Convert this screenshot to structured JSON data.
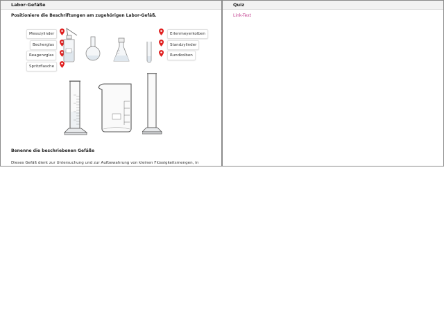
{
  "left": {
    "title": "Labor-Gefäße",
    "instruction": "Positioniere die Beschriftungen am zugehörigen Labor-Gefäß.",
    "labels_left": [
      "Messzylinder",
      "Becherglas",
      "Reagenzglas",
      "Spritzflasche"
    ],
    "labels_right": [
      "Erlenmeyerkolben",
      "Standzylinder",
      "Rundkolben"
    ],
    "section_title": "Benenne die beschriebenen Gefäße",
    "paragraph": "Dieses Gefäß dient zur Untersuchung und zur Aufbewahrung von kleinen Flüssigkeitsmengen, in",
    "pin_color": "#e02020"
  },
  "right": {
    "title": "Quiz",
    "link": "Link-Text",
    "link_color": "#c0398c"
  }
}
